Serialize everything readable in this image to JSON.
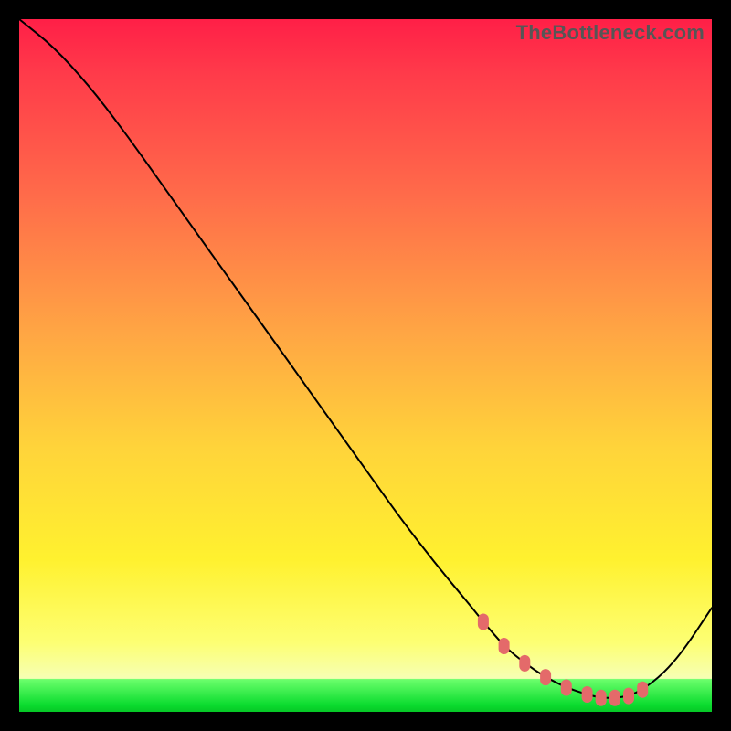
{
  "watermark": "TheBottleneck.com",
  "chart_data": {
    "type": "line",
    "title": "",
    "xlabel": "",
    "ylabel": "",
    "xlim": [
      0,
      100
    ],
    "ylim": [
      0,
      100
    ],
    "grid": false,
    "legend": false,
    "series": [
      {
        "name": "bottleneck-curve",
        "x": [
          0,
          5,
          10,
          15,
          20,
          25,
          30,
          35,
          40,
          45,
          50,
          55,
          60,
          65,
          67,
          70,
          73,
          76,
          79,
          82,
          84,
          86,
          88,
          90,
          93,
          96,
          100
        ],
        "y": [
          100,
          96,
          90.5,
          84,
          77,
          70,
          63,
          56,
          49,
          42,
          35,
          28,
          21.5,
          15.5,
          13,
          9.5,
          7,
          5,
          3.5,
          2.5,
          2,
          2,
          2.3,
          3.2,
          5.5,
          9,
          15
        ]
      }
    ],
    "markers": {
      "name": "highlight-points",
      "x": [
        67,
        70,
        73,
        76,
        79,
        82,
        84,
        86,
        88,
        90
      ],
      "y": [
        13,
        9.5,
        7,
        5,
        3.5,
        2.5,
        2,
        2,
        2.3,
        3.2
      ]
    },
    "background_bands": [
      {
        "color": "#ff1f47",
        "from": 100,
        "to": 80
      },
      {
        "color": "#ff8a44",
        "from": 80,
        "to": 50
      },
      {
        "color": "#ffe52f",
        "from": 50,
        "to": 10
      },
      {
        "color": "#0bdc2f",
        "from": 5,
        "to": 0
      }
    ]
  }
}
